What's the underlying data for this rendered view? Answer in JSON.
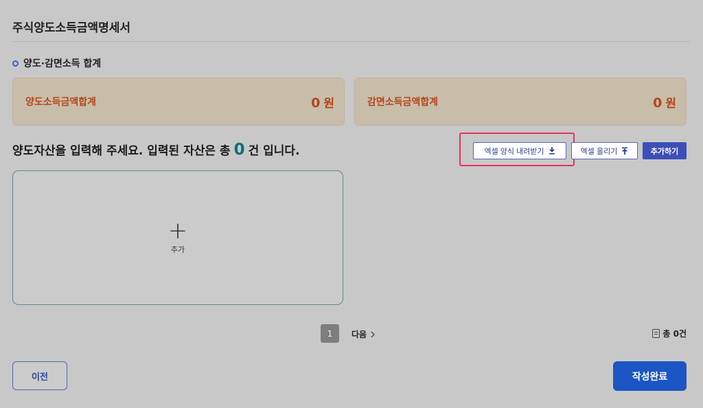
{
  "page": {
    "title": "주식양도소득금액명세서"
  },
  "summary": {
    "section_title": "양도·감면소득 합계",
    "transfer_label": "양도소득금액합계",
    "transfer_value": "0",
    "transfer_unit": "원",
    "exempt_label": "감면소득금액합계",
    "exempt_value": "0",
    "exempt_unit": "원"
  },
  "assets": {
    "prompt_before": "양도자산을 입력해 주세요. 입력된 자산은 총",
    "count": "0",
    "prompt_after": "건 입니다.",
    "add_label": "추가"
  },
  "toolbar": {
    "download_label": "엑셀 양식 내려받기",
    "upload_label": "엑셀 올리기",
    "add_label": "추가하기"
  },
  "pager": {
    "current": "1",
    "next_label": "다음",
    "total_label": "총 0건"
  },
  "footer": {
    "prev_label": "이전",
    "complete_label": "작성완료"
  },
  "colors": {
    "accent": "#1c55c4",
    "summary_text": "#b5451b",
    "count_color": "#0e6f7a",
    "highlight": "#e8315a"
  }
}
